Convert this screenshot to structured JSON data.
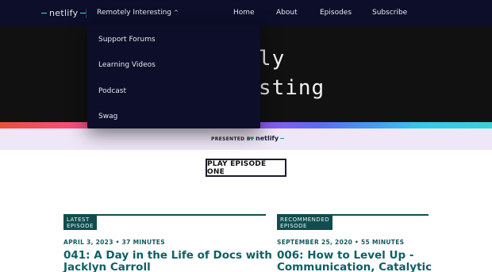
{
  "nav": {
    "logo_text": "netlify",
    "menu_label": "Remotely Interesting",
    "links": [
      "Home",
      "About",
      "Episodes",
      "Subscribe"
    ]
  },
  "dropdown": {
    "items": [
      "Support Forums",
      "Learning Videos",
      "Podcast",
      "Swag"
    ]
  },
  "hero": {
    "title_line1": "Remotely",
    "title_line2": "Interesting",
    "visible_line1": "motely",
    "visible_line2": "teresting"
  },
  "sponsor": {
    "presented_by": "PRESENTED BY",
    "logo_text": "netlify"
  },
  "play_button": "PLAY EPISODE ONE",
  "episodes": [
    {
      "tag": "LATEST EPISODE",
      "meta": "APRIL 3, 2023 • 37 MINUTES",
      "title_line1": "041: A Day in the Life of Docs with",
      "title_line2": "Jacklyn Carroll"
    },
    {
      "tag": "RECOMMENDED EPISODE",
      "meta": "SEPTEMBER 25, 2020 • 55 MINUTES",
      "title_line1": "006: How to Level Up -",
      "title_line2": "Communication, Catalytic"
    }
  ],
  "colors": {
    "nav_bg": "#0c0e2a",
    "accent_teal": "#114c4e",
    "title_teal": "#0f6064",
    "presented_bg": "#efe6f7"
  }
}
